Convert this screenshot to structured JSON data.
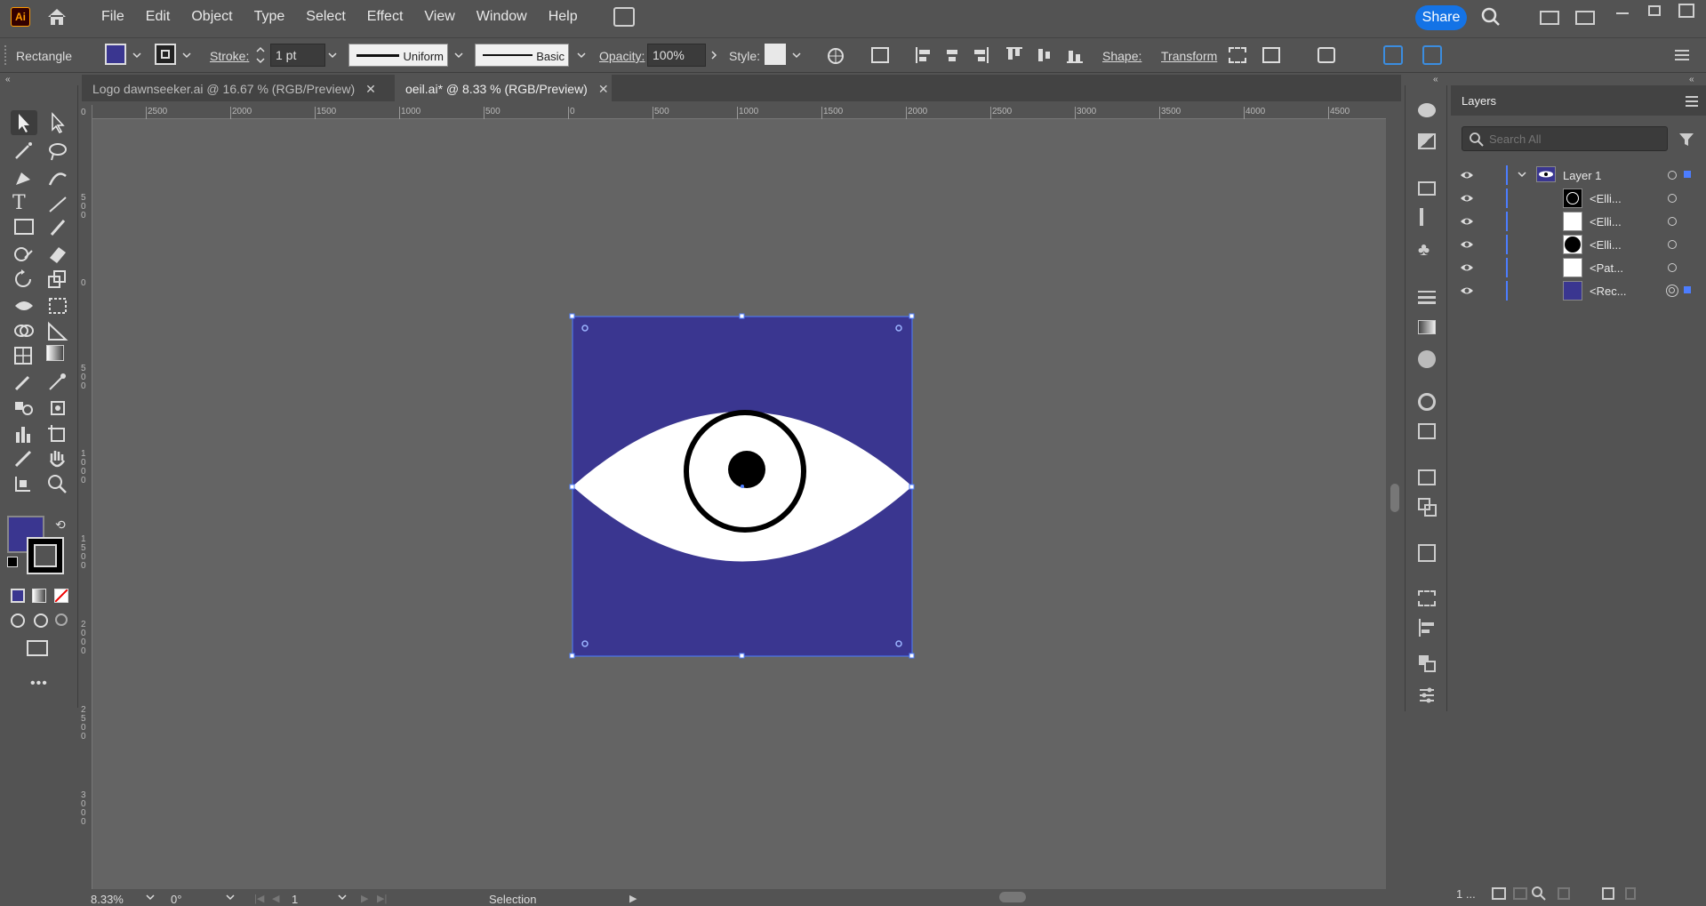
{
  "app": {
    "logo": "Ai",
    "menu": [
      "File",
      "Edit",
      "Object",
      "Type",
      "Select",
      "Effect",
      "View",
      "Window",
      "Help"
    ],
    "share_label": "Share"
  },
  "control_bar": {
    "object_type": "Rectangle",
    "fill_color": "#3a3690",
    "stroke_label": "Stroke:",
    "stroke_value": "1 pt",
    "stroke_profile": "Uniform",
    "brush": "Basic",
    "opacity_label": "Opacity:",
    "opacity_value": "100%",
    "style_label": "Style:",
    "shape_label": "Shape:",
    "transform_label": "Transform"
  },
  "tabs": [
    {
      "label": "Logo dawnseeker.ai @ 16.67 % (RGB/Preview)"
    },
    {
      "label": "oeil.ai* @ 8.33 % (RGB/Preview)"
    }
  ],
  "ruler": {
    "h_ticks": [
      "2500",
      "2000",
      "1500",
      "1000",
      "500",
      "0",
      "500",
      "1000",
      "1500",
      "2000",
      "2500",
      "3000",
      "3500",
      "4000",
      "4500"
    ],
    "v_ticks": [
      "0",
      "5\n0\n0",
      "0",
      "5\n0\n0",
      "1\n0\n0\n0",
      "1\n5\n0\n0",
      "2\n0\n0\n0",
      "2\n5\n0\n0",
      "3\n0\n0\n0"
    ]
  },
  "artwork": {
    "bg_color": "#3a3690",
    "eye_color": "#ffffff",
    "pupil_color": "#000000"
  },
  "status": {
    "zoom": "8.33%",
    "rotation": "0°",
    "artboard": "1",
    "tool": "Selection"
  },
  "layers_panel": {
    "title": "Layers",
    "search_placeholder": "Search All",
    "layer_name": "Layer 1",
    "items": [
      {
        "label": "<Elli...",
        "thumb": "black-circle"
      },
      {
        "label": "<Elli...",
        "thumb": "white"
      },
      {
        "label": "<Elli...",
        "thumb": "black-circle"
      },
      {
        "label": "<Pat...",
        "thumb": "white"
      },
      {
        "label": "<Rec...",
        "thumb": "blue"
      }
    ],
    "footer_count": "1 ..."
  }
}
